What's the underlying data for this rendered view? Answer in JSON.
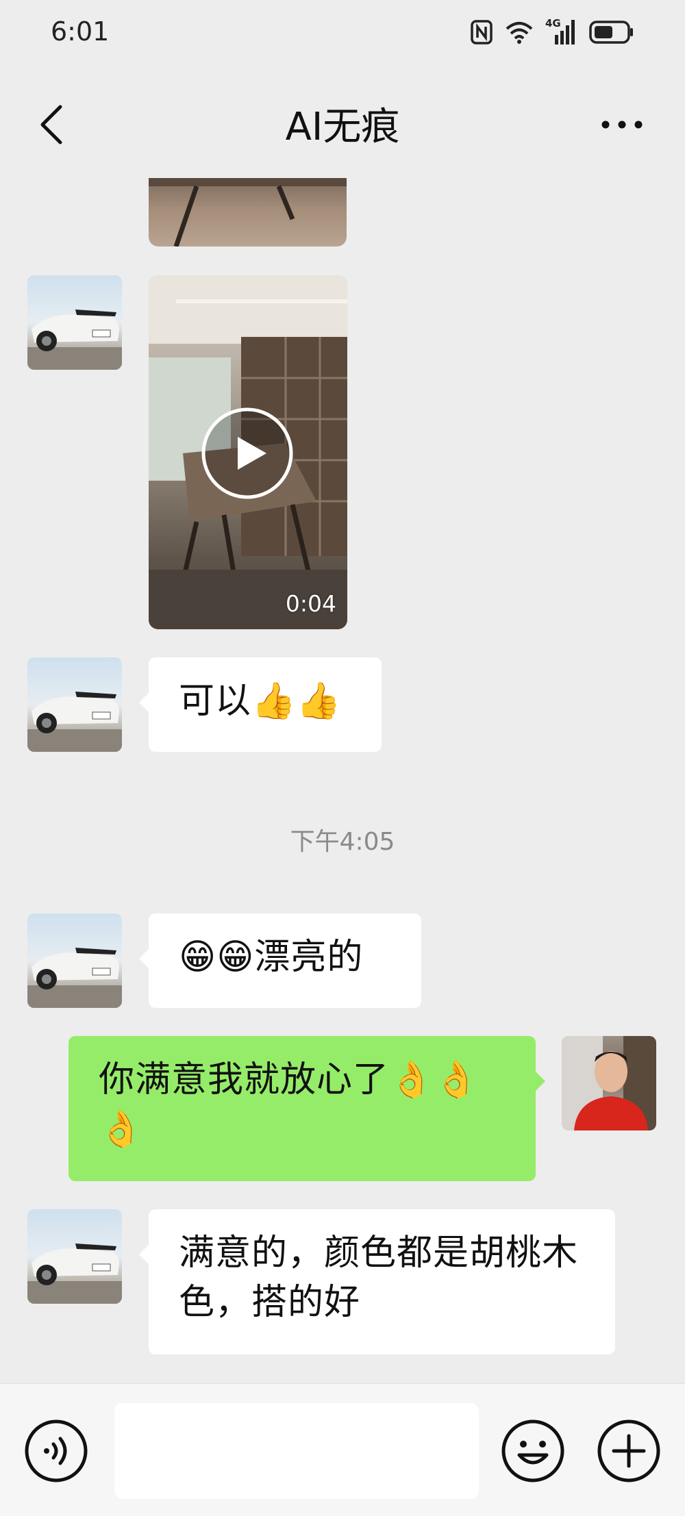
{
  "status_bar": {
    "time": "6:01",
    "icons": [
      "nfc-icon",
      "wifi-icon",
      "cellular-4g-icon",
      "battery-icon"
    ],
    "network_label": "4G"
  },
  "header": {
    "title": "AI无痕",
    "back_icon": "chevron-left-icon",
    "more_icon": "more-dots-icon"
  },
  "messages": [
    {
      "type": "image",
      "side": "left",
      "partial": true
    },
    {
      "type": "video",
      "side": "left",
      "duration": "0:04"
    },
    {
      "type": "text",
      "side": "left",
      "text": "可以👍👍"
    },
    {
      "type": "timestamp",
      "text": "下午4:05"
    },
    {
      "type": "text",
      "side": "left",
      "text": "😁😁漂亮的"
    },
    {
      "type": "text",
      "side": "right",
      "text": "你满意我就放心了👌👌👌"
    },
    {
      "type": "text",
      "side": "left",
      "text": "满意的，颜色都是胡桃木色，搭的好"
    }
  ],
  "input_bar": {
    "voice_icon": "voice-icon",
    "input_value": "",
    "emoji_icon": "emoji-icon",
    "plus_icon": "plus-icon"
  },
  "colors": {
    "background": "#ededed",
    "bubble_left": "#ffffff",
    "bubble_right": "#95ec69",
    "timestamp": "#8a8a8a"
  }
}
